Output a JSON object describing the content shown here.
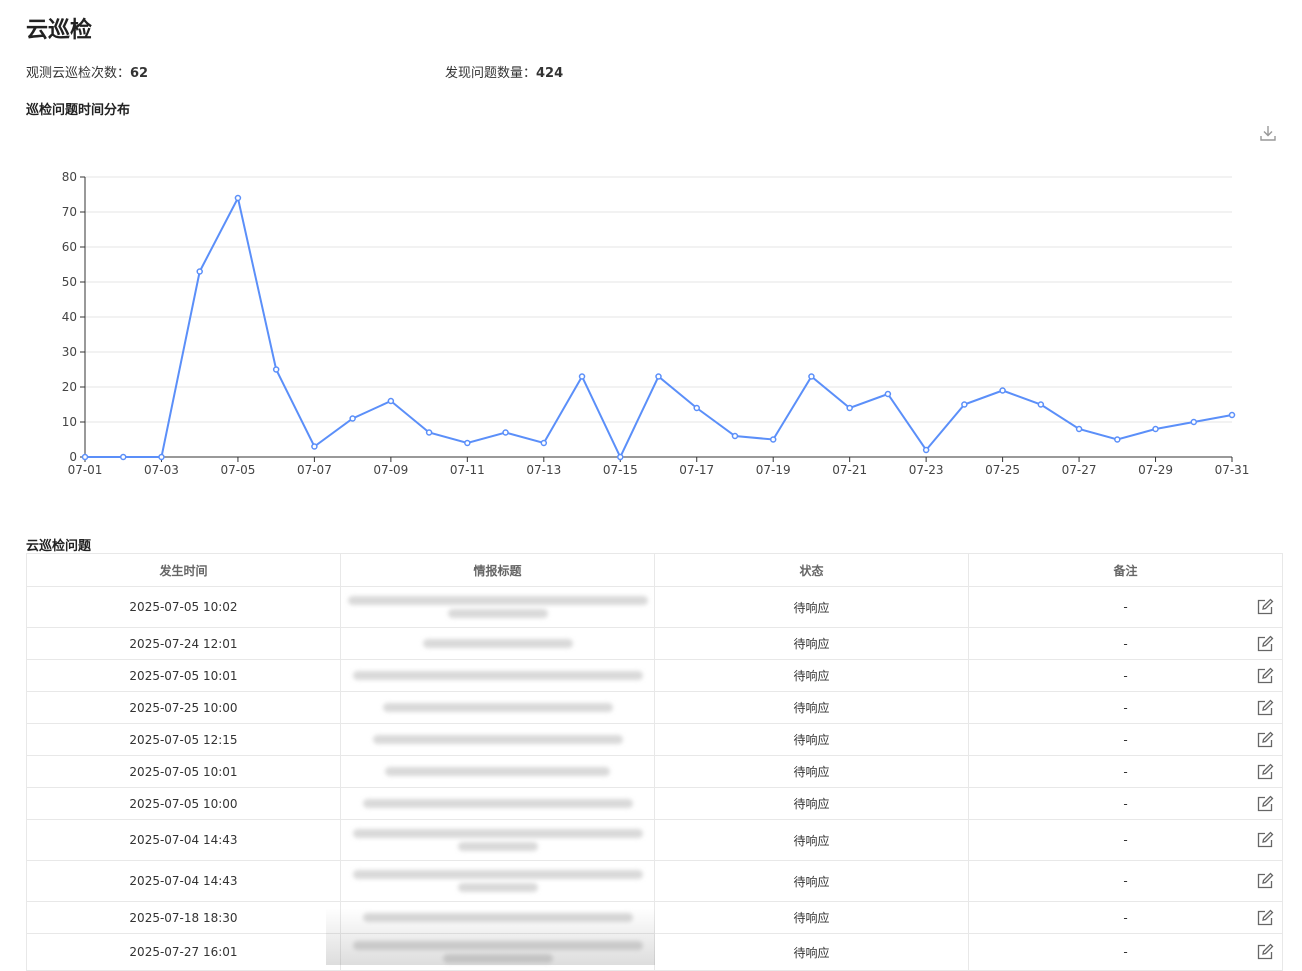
{
  "page": {
    "title": "云巡检",
    "stats": {
      "inspection_label": "观测云巡检次数：",
      "inspection_value": "62",
      "issue_label": "发现问题数量：",
      "issue_value": "424"
    },
    "chart_section_title": "巡检问题时间分布",
    "table_section_title": "云巡检问题"
  },
  "colors": {
    "series": "#5B8FF9",
    "grid": "#e6e6e6",
    "axis": "#333333"
  },
  "icons": {
    "download": "download-icon",
    "edit": "edit-icon"
  },
  "chart_data": {
    "type": "line",
    "title": "",
    "xlabel": "",
    "ylabel": "",
    "ylim": [
      0,
      80
    ],
    "yticks": [
      0,
      10,
      20,
      30,
      40,
      50,
      60,
      70,
      80
    ],
    "x": [
      "07-01",
      "07-02",
      "07-03",
      "07-04",
      "07-05",
      "07-06",
      "07-07",
      "07-08",
      "07-09",
      "07-10",
      "07-11",
      "07-12",
      "07-13",
      "07-14",
      "07-15",
      "07-16",
      "07-17",
      "07-18",
      "07-19",
      "07-20",
      "07-21",
      "07-22",
      "07-23",
      "07-24",
      "07-25",
      "07-26",
      "07-27",
      "07-28",
      "07-29",
      "07-30",
      "07-31"
    ],
    "xtick_labels": [
      "07-01",
      "07-03",
      "07-05",
      "07-07",
      "07-09",
      "07-11",
      "07-13",
      "07-15",
      "07-17",
      "07-19",
      "07-21",
      "07-23",
      "07-25",
      "07-27",
      "07-29",
      "07-31"
    ],
    "series": [
      {
        "values": [
          0,
          0,
          0,
          53,
          74,
          25,
          3,
          11,
          16,
          7,
          4,
          7,
          4,
          23,
          0,
          23,
          14,
          6,
          5,
          23,
          14,
          18,
          2,
          15,
          19,
          15,
          8,
          5,
          8,
          10,
          12
        ]
      }
    ],
    "grid": true,
    "legend": "none"
  },
  "table": {
    "headers": [
      "发生时间",
      "情报标题",
      "状态",
      "备注"
    ],
    "rows": [
      {
        "time": "2025-07-05 10:02",
        "status": "待响应",
        "note": "-"
      },
      {
        "time": "2025-07-24 12:01",
        "status": "待响应",
        "note": "-"
      },
      {
        "time": "2025-07-05 10:01",
        "status": "待响应",
        "note": "-"
      },
      {
        "time": "2025-07-25 10:00",
        "status": "待响应",
        "note": "-"
      },
      {
        "time": "2025-07-05 12:15",
        "status": "待响应",
        "note": "-"
      },
      {
        "time": "2025-07-05 10:01",
        "status": "待响应",
        "note": "-"
      },
      {
        "time": "2025-07-05 10:00",
        "status": "待响应",
        "note": "-"
      },
      {
        "time": "2025-07-04 14:43",
        "status": "待响应",
        "note": "-"
      },
      {
        "time": "2025-07-04 14:43",
        "status": "待响应",
        "note": "-"
      },
      {
        "time": "2025-07-18 18:30",
        "status": "待响应",
        "note": "-"
      },
      {
        "time": "2025-07-27 16:01",
        "status": "待响应",
        "note": "-"
      }
    ]
  }
}
